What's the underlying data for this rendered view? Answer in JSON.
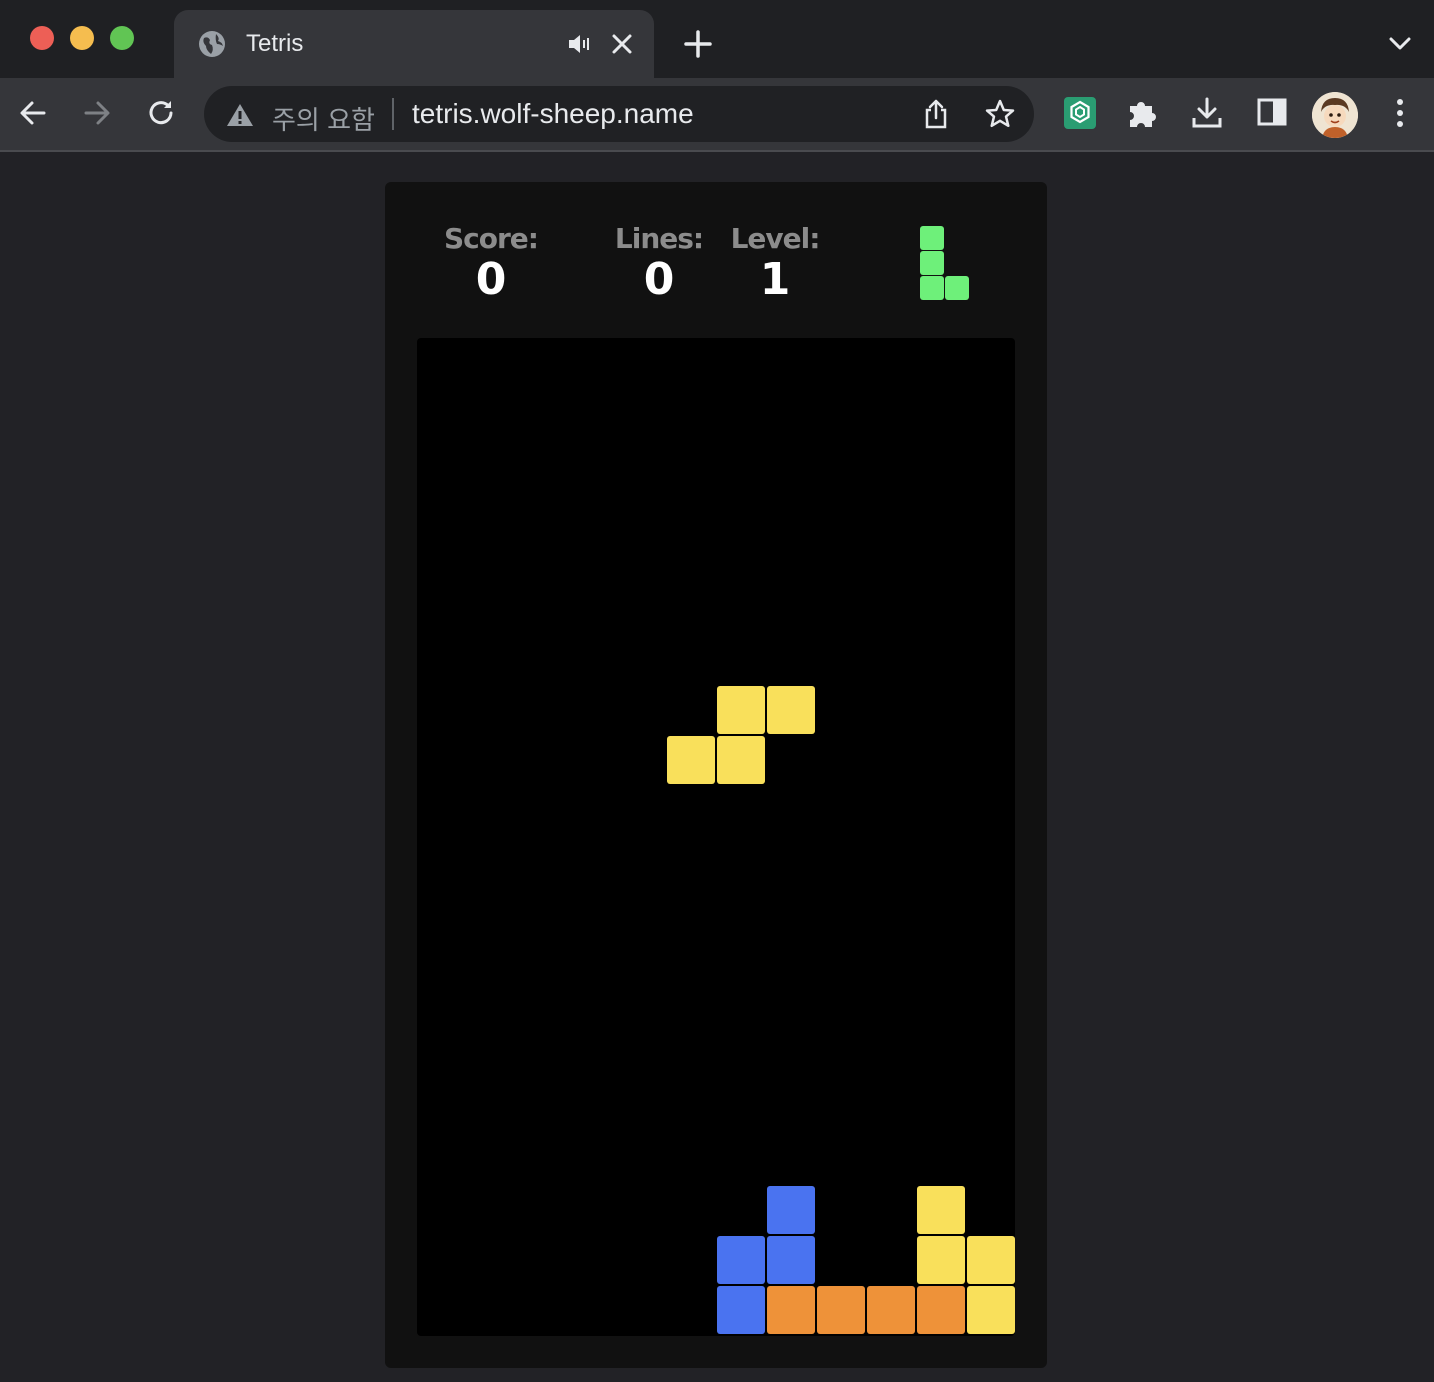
{
  "browser": {
    "tab_title": "Tetris",
    "security_label": "주의 요함",
    "url": "tetris.wolf-sheep.name",
    "traffic_lights": [
      "#ed5f56",
      "#f5bd4f",
      "#61c554"
    ]
  },
  "game": {
    "score_label": "Score:",
    "score": "0",
    "lines_label": "Lines:",
    "lines": "0",
    "level_label": "Level:",
    "level": "1",
    "colors": {
      "Y": "#f9e05b",
      "B": "#4a73f0",
      "O": "#ee9239",
      "G": "#6ef07a"
    },
    "next_piece": {
      "color": "G",
      "cells": [
        [
          0,
          0
        ],
        [
          0,
          1
        ],
        [
          0,
          2
        ],
        [
          1,
          2
        ]
      ]
    },
    "board": {
      "cols": 12,
      "rows": 20,
      "active_piece": {
        "color": "Y",
        "cells": [
          [
            6,
            7
          ],
          [
            7,
            7
          ],
          [
            5,
            8
          ],
          [
            6,
            8
          ]
        ]
      },
      "filled": [
        [
          7,
          17,
          "B"
        ],
        [
          10,
          17,
          "Y"
        ],
        [
          6,
          18,
          "B"
        ],
        [
          7,
          18,
          "B"
        ],
        [
          10,
          18,
          "Y"
        ],
        [
          11,
          18,
          "Y"
        ],
        [
          6,
          19,
          "B"
        ],
        [
          7,
          19,
          "O"
        ],
        [
          8,
          19,
          "O"
        ],
        [
          9,
          19,
          "O"
        ],
        [
          10,
          19,
          "O"
        ],
        [
          11,
          19,
          "Y"
        ]
      ]
    }
  }
}
